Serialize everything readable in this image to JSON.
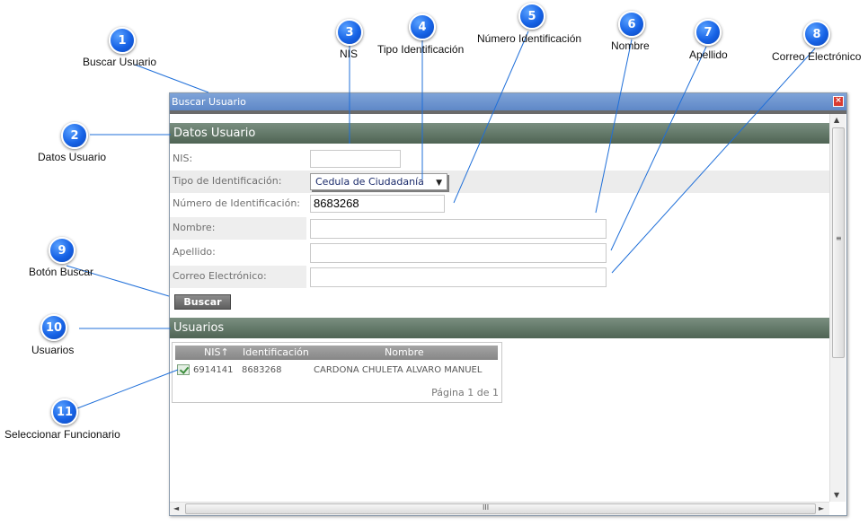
{
  "callouts": [
    {
      "num": "1",
      "label": "Buscar Usuario"
    },
    {
      "num": "2",
      "label": "Datos Usuario"
    },
    {
      "num": "3",
      "label": "NIS"
    },
    {
      "num": "4",
      "label": "Tipo Identificación"
    },
    {
      "num": "5",
      "label": "Número Identificación"
    },
    {
      "num": "6",
      "label": "Nombre"
    },
    {
      "num": "7",
      "label": "Apellido"
    },
    {
      "num": "8",
      "label": "Correo Electrónico"
    },
    {
      "num": "9",
      "label": "Botón Buscar"
    },
    {
      "num": "10",
      "label": "Usuarios"
    },
    {
      "num": "11",
      "label": "Seleccionar Funcionario"
    }
  ],
  "window": {
    "title": "Buscar Usuario",
    "close_glyph": "×"
  },
  "datos_usuario": {
    "header": "Datos Usuario",
    "nis_label": "NIS:",
    "nis_value": "",
    "tipo_label": "Tipo de Identificación:",
    "tipo_value": "Cedula de Ciudadanía",
    "numero_label": "Número de Identificación:",
    "numero_value": "8683268",
    "nombre_label": "Nombre:",
    "nombre_value": "",
    "apellido_label": "Apellido:",
    "apellido_value": "",
    "correo_label": "Correo Electrónico:",
    "correo_value": "",
    "buscar_label": "Buscar"
  },
  "usuarios": {
    "header": "Usuarios",
    "columns": [
      "NIS↑",
      "Identificación",
      "Nombre"
    ],
    "rows": [
      {
        "nis": "6914141",
        "identificacion": "8683268",
        "nombre": "CARDONA CHULETA ALVARO MANUEL"
      }
    ],
    "pager": "Página 1 de 1"
  },
  "scrollbar": {
    "up": "▲",
    "down": "▼",
    "left": "◄",
    "right": "►",
    "grip_v": "≡",
    "grip_h": "III"
  },
  "icons": {
    "select_arrow": "chevron-down-icon",
    "row_select": "select-row-icon",
    "close": "close-icon"
  }
}
